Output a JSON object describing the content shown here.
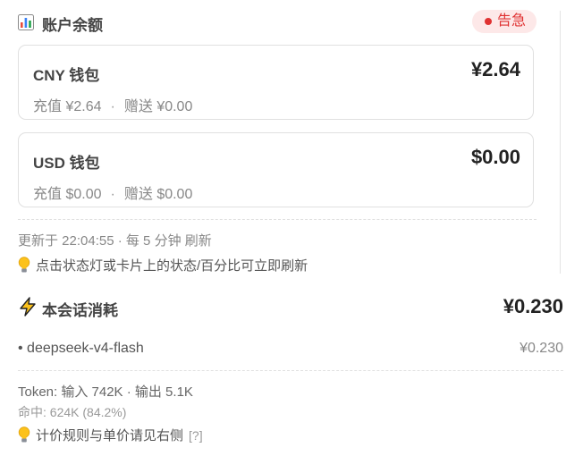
{
  "header": {
    "title": "账户余额",
    "icon": "bar-chart-icon",
    "badge": {
      "label": "告急",
      "color": "#e03131",
      "background": "#fde8e8"
    }
  },
  "wallets": [
    {
      "name": "CNY 钱包",
      "amount": "¥2.64",
      "recharge_label": "充值",
      "recharge_value": "¥2.64",
      "gift_label": "赠送",
      "gift_value": "¥0.00"
    },
    {
      "name": "USD 钱包",
      "amount": "$0.00",
      "recharge_label": "充值",
      "recharge_value": "$0.00",
      "gift_label": "赠送",
      "gift_value": "$0.00"
    }
  ],
  "separator": "·",
  "status": {
    "updated": "更新于 22:04:55 · 每 5 分钟 刷新",
    "tip": "点击状态灯或卡片上的状态/百分比可立即刷新",
    "tip_icon": "lightbulb-icon"
  },
  "session": {
    "title": "本会话消耗",
    "icon": "lightning-icon",
    "total": "¥0.230",
    "models": [
      {
        "name": "• deepseek-v4-flash",
        "cost": "¥0.230"
      }
    ],
    "tokens": "Token: 输入 742K · 输出 5.1K",
    "hits": "命中: 624K (84.2%)",
    "tip": "计价规则与单价请见右侧",
    "help": "[?]"
  }
}
